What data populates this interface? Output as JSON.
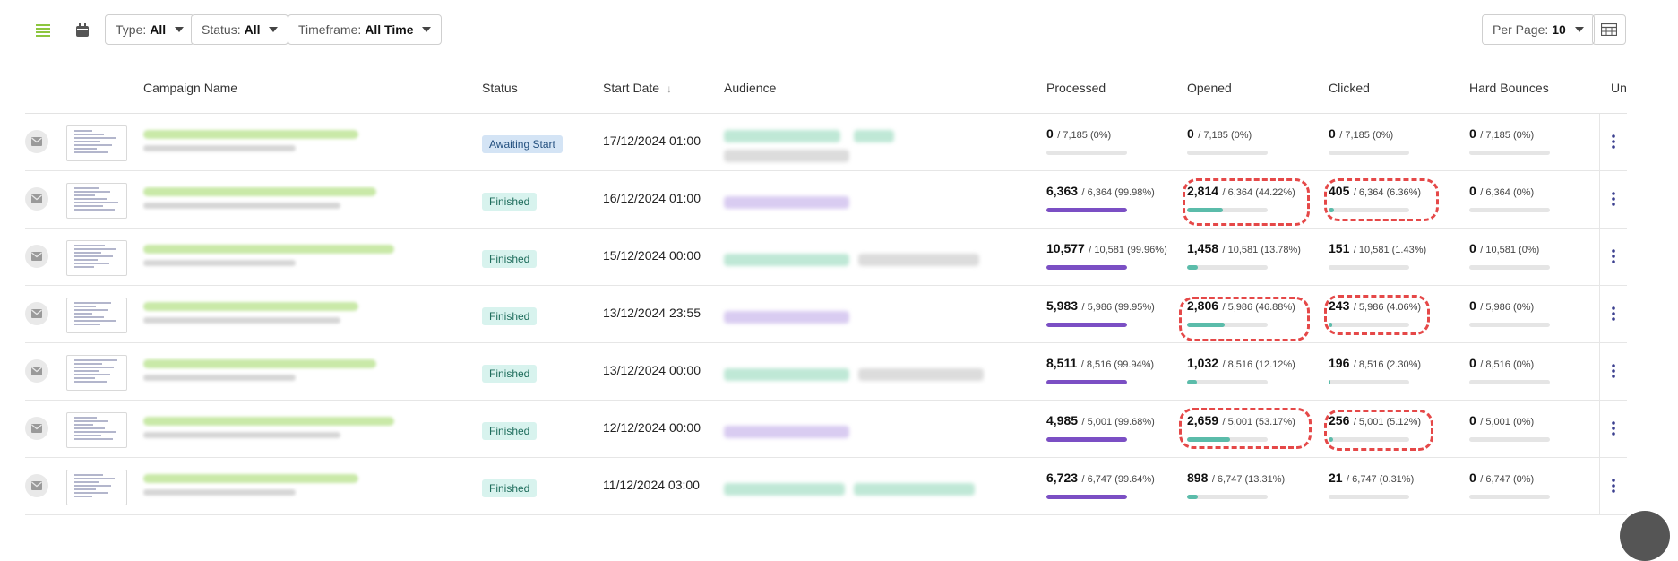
{
  "toolbar": {
    "list_view_icon": "list-icon",
    "calendar_icon": "calendar-icon",
    "filters": [
      {
        "label": "Type:",
        "value": "All"
      },
      {
        "label": "Status:",
        "value": "All"
      },
      {
        "label": "Timeframe:",
        "value": "All Time"
      }
    ],
    "per_page": {
      "label": "Per Page:",
      "value": "10"
    },
    "columns_icon": "table-columns-icon"
  },
  "table": {
    "headers": [
      "Campaign Name",
      "Status",
      "Start Date",
      "Audience",
      "Processed",
      "Opened",
      "Clicked",
      "Hard Bounces",
      "Un"
    ],
    "rows": [
      {
        "status": "Awaiting Start",
        "status_type": "awaiting",
        "date": "17/12/2024 01:00",
        "processed": {
          "value": "0",
          "detail": "/ 7,185 (0%)",
          "pct": 0
        },
        "opened": {
          "value": "0",
          "detail": "/ 7,185 (0%)",
          "pct": 0
        },
        "clicked": {
          "value": "0",
          "detail": "/ 7,185 (0%)",
          "pct": 0
        },
        "bounces": {
          "value": "0",
          "detail": "/ 7,185 (0%)",
          "pct": 0
        }
      },
      {
        "status": "Finished",
        "status_type": "finished",
        "date": "16/12/2024 01:00",
        "processed": {
          "value": "6,363",
          "detail": "/ 6,364 (99.98%)",
          "pct": 99.98
        },
        "opened": {
          "value": "2,814",
          "detail": "/ 6,364 (44.22%)",
          "pct": 44.22
        },
        "clicked": {
          "value": "405",
          "detail": "/ 6,364 (6.36%)",
          "pct": 6.36
        },
        "bounces": {
          "value": "0",
          "detail": "/ 6,364 (0%)",
          "pct": 0
        }
      },
      {
        "status": "Finished",
        "status_type": "finished",
        "date": "15/12/2024 00:00",
        "processed": {
          "value": "10,577",
          "detail": "/ 10,581 (99.96%)",
          "pct": 99.96
        },
        "opened": {
          "value": "1,458",
          "detail": "/ 10,581 (13.78%)",
          "pct": 13.78
        },
        "clicked": {
          "value": "151",
          "detail": "/ 10,581 (1.43%)",
          "pct": 1.43
        },
        "bounces": {
          "value": "0",
          "detail": "/ 10,581 (0%)",
          "pct": 0
        }
      },
      {
        "status": "Finished",
        "status_type": "finished",
        "date": "13/12/2024 23:55",
        "processed": {
          "value": "5,983",
          "detail": "/ 5,986 (99.95%)",
          "pct": 99.95
        },
        "opened": {
          "value": "2,806",
          "detail": "/ 5,986 (46.88%)",
          "pct": 46.88
        },
        "clicked": {
          "value": "243",
          "detail": "/ 5,986 (4.06%)",
          "pct": 4.06
        },
        "bounces": {
          "value": "0",
          "detail": "/ 5,986 (0%)",
          "pct": 0
        }
      },
      {
        "status": "Finished",
        "status_type": "finished",
        "date": "13/12/2024 00:00",
        "processed": {
          "value": "8,511",
          "detail": "/ 8,516 (99.94%)",
          "pct": 99.94
        },
        "opened": {
          "value": "1,032",
          "detail": "/ 8,516 (12.12%)",
          "pct": 12.12
        },
        "clicked": {
          "value": "196",
          "detail": "/ 8,516 (2.30%)",
          "pct": 2.3
        },
        "bounces": {
          "value": "0",
          "detail": "/ 8,516 (0%)",
          "pct": 0
        }
      },
      {
        "status": "Finished",
        "status_type": "finished",
        "date": "12/12/2024 00:00",
        "processed": {
          "value": "4,985",
          "detail": "/ 5,001 (99.68%)",
          "pct": 99.68
        },
        "opened": {
          "value": "2,659",
          "detail": "/ 5,001 (53.17%)",
          "pct": 53.17
        },
        "clicked": {
          "value": "256",
          "detail": "/ 5,001 (5.12%)",
          "pct": 5.12
        },
        "bounces": {
          "value": "0",
          "detail": "/ 5,001 (0%)",
          "pct": 0
        }
      },
      {
        "status": "Finished",
        "status_type": "finished",
        "date": "11/12/2024 03:00",
        "processed": {
          "value": "6,723",
          "detail": "/ 6,747 (99.64%)",
          "pct": 99.64
        },
        "opened": {
          "value": "898",
          "detail": "/ 6,747 (13.31%)",
          "pct": 13.31
        },
        "clicked": {
          "value": "21",
          "detail": "/ 6,747 (0.31%)",
          "pct": 0.31
        },
        "bounces": {
          "value": "0",
          "detail": "/ 6,747 (0%)",
          "pct": 0
        }
      }
    ]
  },
  "colors": {
    "accent_green": "#8dc63f",
    "processed_bar": "#7b4fc4",
    "opened_bar": "#5bbcaa",
    "clicked_bar": "#5bbcaa",
    "highlight": "#e54848"
  }
}
